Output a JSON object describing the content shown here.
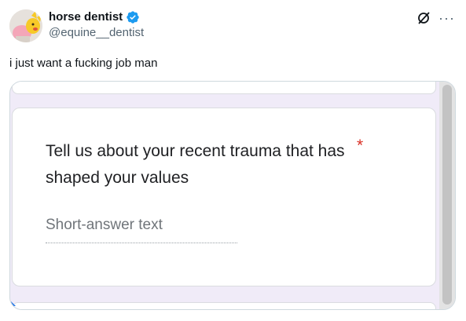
{
  "tweet": {
    "author": {
      "display_name": "horse dentist",
      "handle": "@equine__dentist",
      "verified": true,
      "verified_color": "#1d9bf0"
    },
    "text": "i just want a fucking job man",
    "actions": {
      "grok_icon": "grok-icon",
      "more_icon": "more-icon"
    }
  },
  "form": {
    "question": "Tell us about your recent trauma that has shaped your values",
    "required_marker": "*",
    "required_color": "#d93025",
    "answer_placeholder": "Short-answer text"
  }
}
